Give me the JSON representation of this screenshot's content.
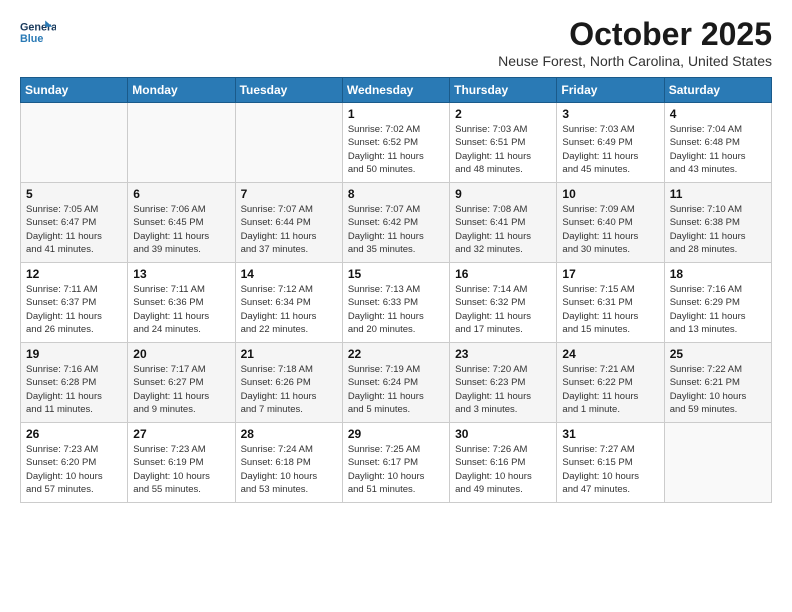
{
  "logo": {
    "line1": "General",
    "line2": "Blue"
  },
  "title": "October 2025",
  "subtitle": "Neuse Forest, North Carolina, United States",
  "weekdays": [
    "Sunday",
    "Monday",
    "Tuesday",
    "Wednesday",
    "Thursday",
    "Friday",
    "Saturday"
  ],
  "weeks": [
    [
      {
        "day": "",
        "info": ""
      },
      {
        "day": "",
        "info": ""
      },
      {
        "day": "",
        "info": ""
      },
      {
        "day": "1",
        "info": "Sunrise: 7:02 AM\nSunset: 6:52 PM\nDaylight: 11 hours\nand 50 minutes."
      },
      {
        "day": "2",
        "info": "Sunrise: 7:03 AM\nSunset: 6:51 PM\nDaylight: 11 hours\nand 48 minutes."
      },
      {
        "day": "3",
        "info": "Sunrise: 7:03 AM\nSunset: 6:49 PM\nDaylight: 11 hours\nand 45 minutes."
      },
      {
        "day": "4",
        "info": "Sunrise: 7:04 AM\nSunset: 6:48 PM\nDaylight: 11 hours\nand 43 minutes."
      }
    ],
    [
      {
        "day": "5",
        "info": "Sunrise: 7:05 AM\nSunset: 6:47 PM\nDaylight: 11 hours\nand 41 minutes."
      },
      {
        "day": "6",
        "info": "Sunrise: 7:06 AM\nSunset: 6:45 PM\nDaylight: 11 hours\nand 39 minutes."
      },
      {
        "day": "7",
        "info": "Sunrise: 7:07 AM\nSunset: 6:44 PM\nDaylight: 11 hours\nand 37 minutes."
      },
      {
        "day": "8",
        "info": "Sunrise: 7:07 AM\nSunset: 6:42 PM\nDaylight: 11 hours\nand 35 minutes."
      },
      {
        "day": "9",
        "info": "Sunrise: 7:08 AM\nSunset: 6:41 PM\nDaylight: 11 hours\nand 32 minutes."
      },
      {
        "day": "10",
        "info": "Sunrise: 7:09 AM\nSunset: 6:40 PM\nDaylight: 11 hours\nand 30 minutes."
      },
      {
        "day": "11",
        "info": "Sunrise: 7:10 AM\nSunset: 6:38 PM\nDaylight: 11 hours\nand 28 minutes."
      }
    ],
    [
      {
        "day": "12",
        "info": "Sunrise: 7:11 AM\nSunset: 6:37 PM\nDaylight: 11 hours\nand 26 minutes."
      },
      {
        "day": "13",
        "info": "Sunrise: 7:11 AM\nSunset: 6:36 PM\nDaylight: 11 hours\nand 24 minutes."
      },
      {
        "day": "14",
        "info": "Sunrise: 7:12 AM\nSunset: 6:34 PM\nDaylight: 11 hours\nand 22 minutes."
      },
      {
        "day": "15",
        "info": "Sunrise: 7:13 AM\nSunset: 6:33 PM\nDaylight: 11 hours\nand 20 minutes."
      },
      {
        "day": "16",
        "info": "Sunrise: 7:14 AM\nSunset: 6:32 PM\nDaylight: 11 hours\nand 17 minutes."
      },
      {
        "day": "17",
        "info": "Sunrise: 7:15 AM\nSunset: 6:31 PM\nDaylight: 11 hours\nand 15 minutes."
      },
      {
        "day": "18",
        "info": "Sunrise: 7:16 AM\nSunset: 6:29 PM\nDaylight: 11 hours\nand 13 minutes."
      }
    ],
    [
      {
        "day": "19",
        "info": "Sunrise: 7:16 AM\nSunset: 6:28 PM\nDaylight: 11 hours\nand 11 minutes."
      },
      {
        "day": "20",
        "info": "Sunrise: 7:17 AM\nSunset: 6:27 PM\nDaylight: 11 hours\nand 9 minutes."
      },
      {
        "day": "21",
        "info": "Sunrise: 7:18 AM\nSunset: 6:26 PM\nDaylight: 11 hours\nand 7 minutes."
      },
      {
        "day": "22",
        "info": "Sunrise: 7:19 AM\nSunset: 6:24 PM\nDaylight: 11 hours\nand 5 minutes."
      },
      {
        "day": "23",
        "info": "Sunrise: 7:20 AM\nSunset: 6:23 PM\nDaylight: 11 hours\nand 3 minutes."
      },
      {
        "day": "24",
        "info": "Sunrise: 7:21 AM\nSunset: 6:22 PM\nDaylight: 11 hours\nand 1 minute."
      },
      {
        "day": "25",
        "info": "Sunrise: 7:22 AM\nSunset: 6:21 PM\nDaylight: 10 hours\nand 59 minutes."
      }
    ],
    [
      {
        "day": "26",
        "info": "Sunrise: 7:23 AM\nSunset: 6:20 PM\nDaylight: 10 hours\nand 57 minutes."
      },
      {
        "day": "27",
        "info": "Sunrise: 7:23 AM\nSunset: 6:19 PM\nDaylight: 10 hours\nand 55 minutes."
      },
      {
        "day": "28",
        "info": "Sunrise: 7:24 AM\nSunset: 6:18 PM\nDaylight: 10 hours\nand 53 minutes."
      },
      {
        "day": "29",
        "info": "Sunrise: 7:25 AM\nSunset: 6:17 PM\nDaylight: 10 hours\nand 51 minutes."
      },
      {
        "day": "30",
        "info": "Sunrise: 7:26 AM\nSunset: 6:16 PM\nDaylight: 10 hours\nand 49 minutes."
      },
      {
        "day": "31",
        "info": "Sunrise: 7:27 AM\nSunset: 6:15 PM\nDaylight: 10 hours\nand 47 minutes."
      },
      {
        "day": "",
        "info": ""
      }
    ]
  ]
}
